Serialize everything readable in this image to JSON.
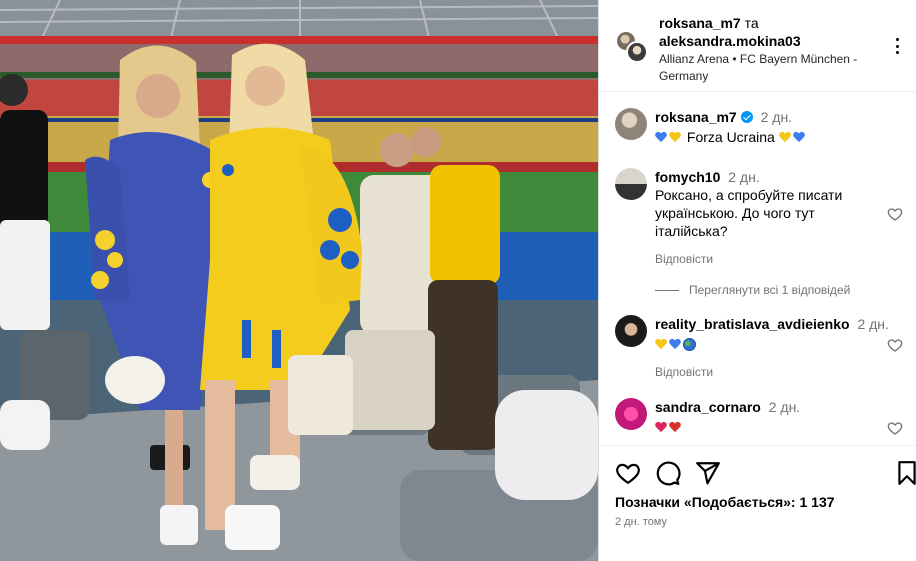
{
  "post": {
    "author_1": "roksana_m7",
    "joiner": "та",
    "author_2": "aleksandra.mokina03",
    "location": "Allianz Arena • FC Bayern München - Germany"
  },
  "caption": {
    "user": "roksana_m7",
    "time": "2 дн.",
    "text": "Forza Ucraina"
  },
  "comments": [
    {
      "user": "fomych10",
      "time": "2 дн.",
      "text": "Роксано, а спробуйте писати українською. До чого тут італійська?",
      "reply_label": "Відповісти"
    },
    {
      "user": "reality_bratislava_avdieienko",
      "time": "2 дн.",
      "reply_label": "Відповісти"
    },
    {
      "user": "sandra_cornaro",
      "time": "2 дн."
    }
  ],
  "view_replies": "Переглянути всі 1 відповідей",
  "likes_text": "Позначки «Подобається»: 1 137",
  "posted_ago": "2 дн. тому",
  "colors": {
    "accent_blue": "#0095f6",
    "secondary_text": "#737373",
    "border": "#dbdbdb",
    "heart_blue": "#3b7ded",
    "heart_yellow": "#f5c518",
    "heart_red": "#e0245e"
  },
  "icons": [
    "more-options-icon",
    "like-heart-icon",
    "comment-icon",
    "share-icon",
    "save-bookmark-icon",
    "verified-badge-icon"
  ]
}
